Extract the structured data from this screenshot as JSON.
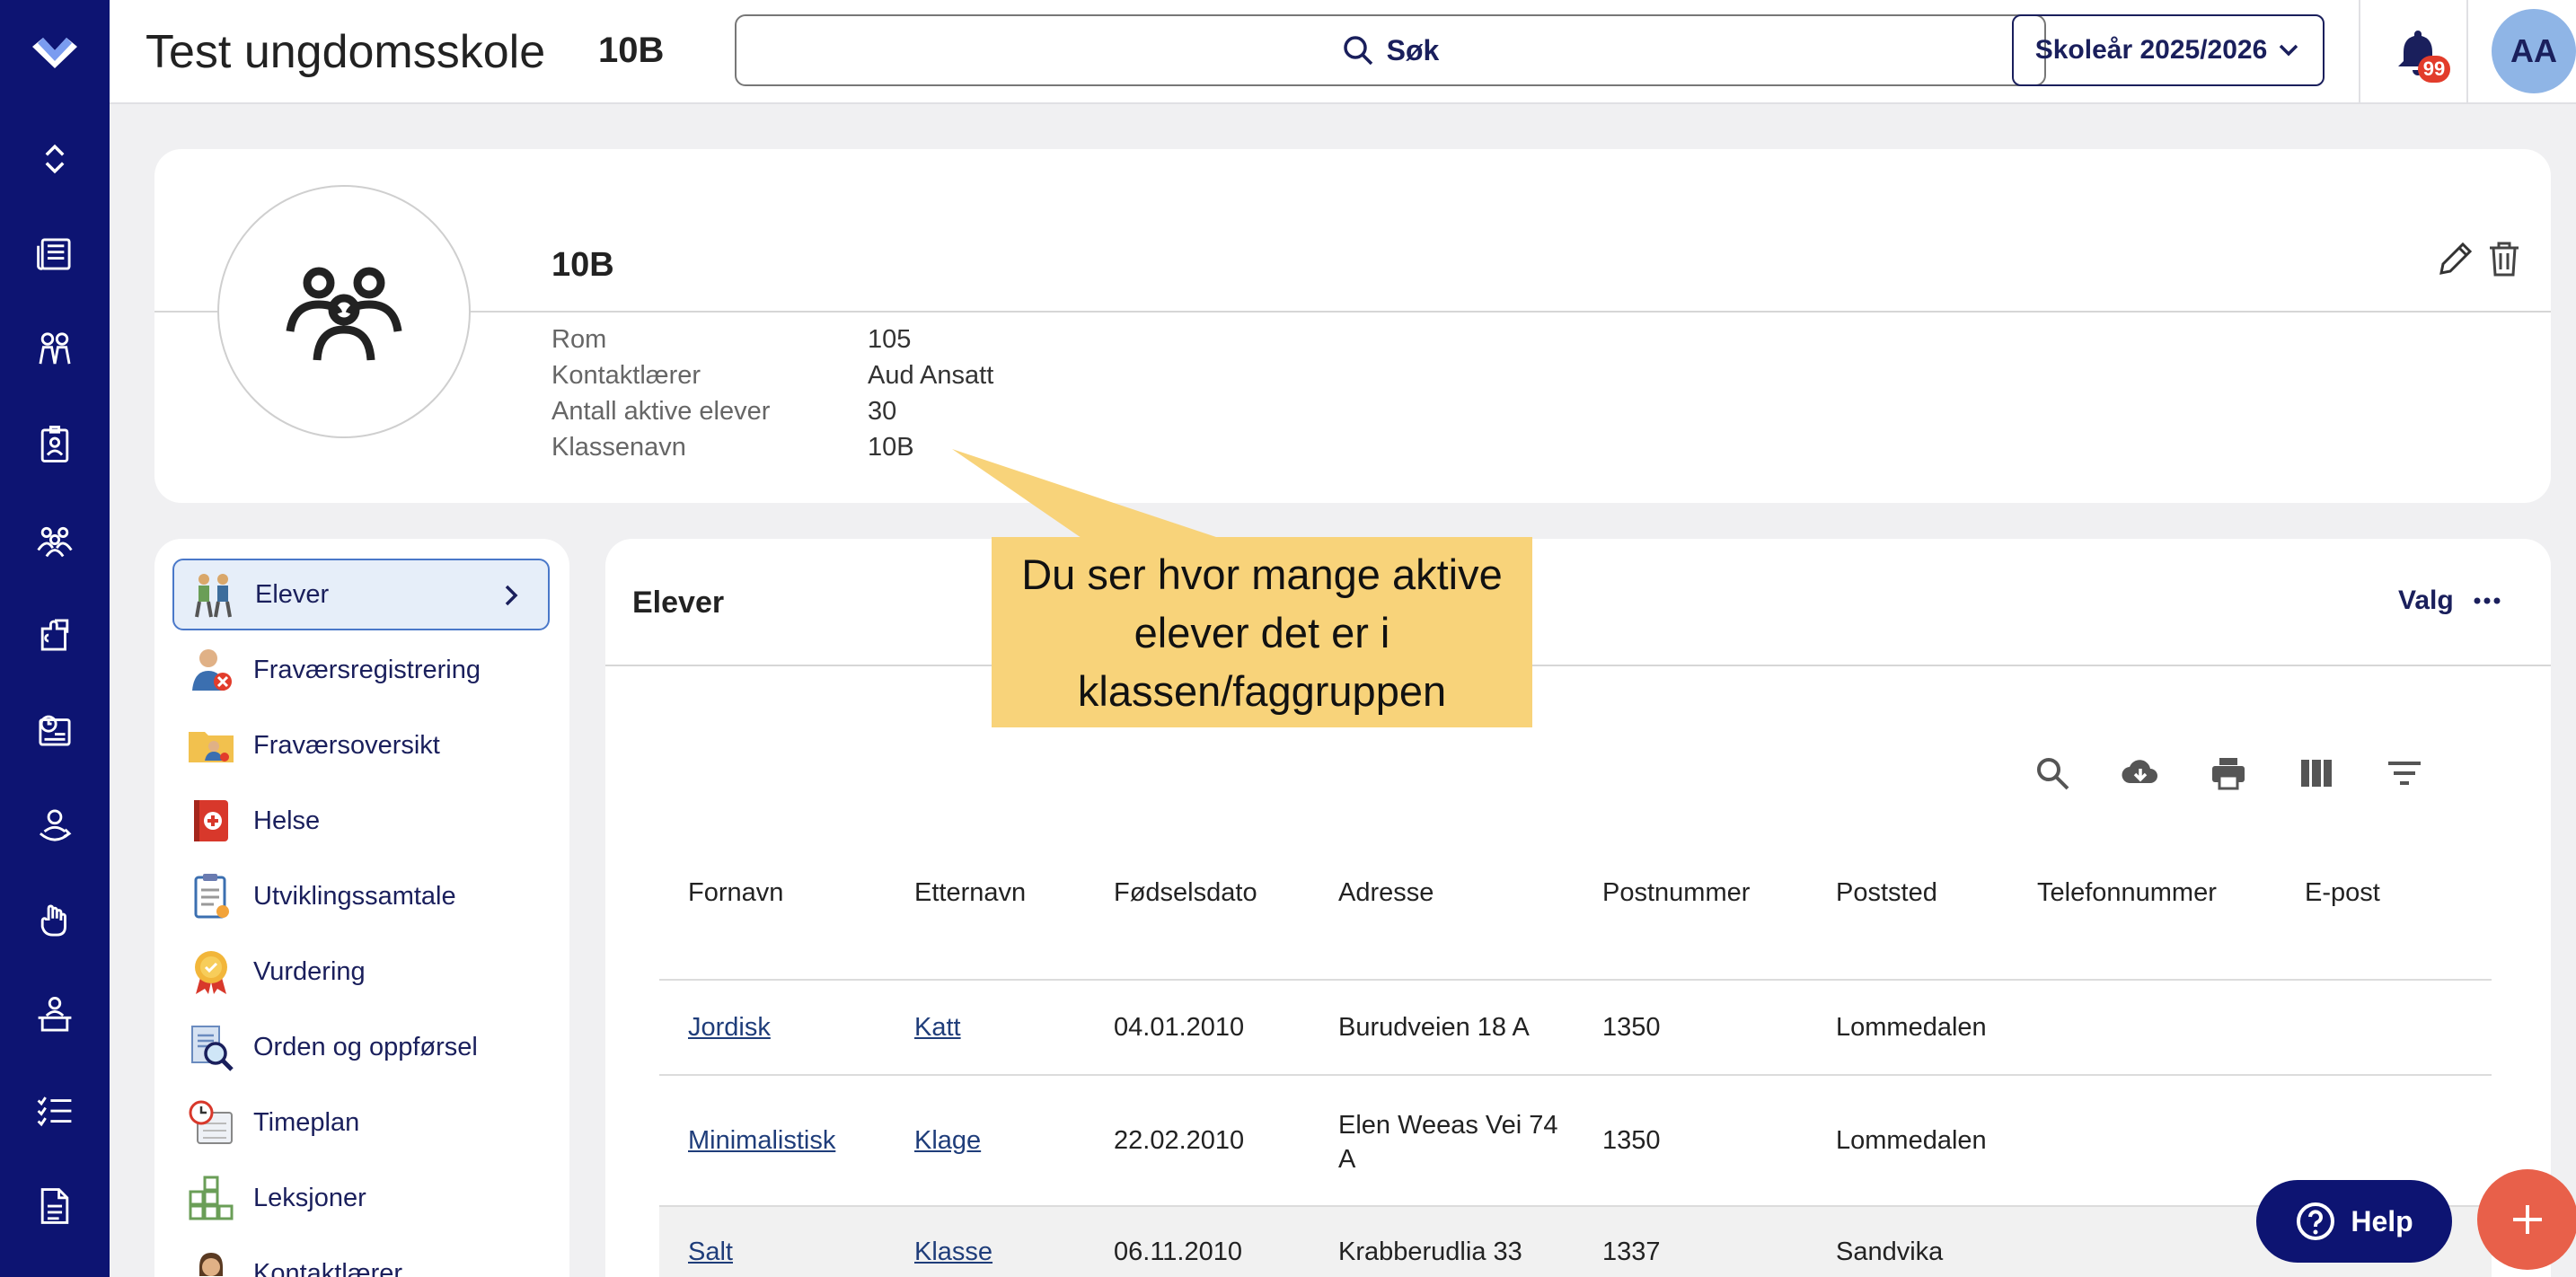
{
  "rail": {
    "icons": [
      "logo-icon",
      "expand-collapse-icon",
      "news-icon",
      "students-icon",
      "badge-icon",
      "groups-icon",
      "puzzle-icon",
      "schedule-icon",
      "user-rotate-icon",
      "hand-icon",
      "teacher-desk-icon",
      "checklist-icon",
      "document-icon"
    ]
  },
  "topbar": {
    "school": "Test ungdomsskole",
    "class": "10B",
    "search_label": "Søk",
    "year_label": "Skoleår 2025/2026",
    "notification_count": "99",
    "avatar_initials": "AA"
  },
  "info": {
    "name": "10B",
    "rows": [
      {
        "label": "Rom",
        "value": "105"
      },
      {
        "label": "Kontaktlærer",
        "value": "Aud Ansatt"
      },
      {
        "label": "Antall aktive elever",
        "value": "30"
      },
      {
        "label": "Klassenavn",
        "value": "10B"
      }
    ]
  },
  "menu": {
    "items": [
      {
        "label": "Elever",
        "icon": "students-hiking-icon"
      },
      {
        "label": "Fraværsregistrering",
        "icon": "absence-register-icon"
      },
      {
        "label": "Fraværsoversikt",
        "icon": "absence-folder-icon"
      },
      {
        "label": "Helse",
        "icon": "health-icon"
      },
      {
        "label": "Utviklingssamtale",
        "icon": "clipboard-icon"
      },
      {
        "label": "Vurdering",
        "icon": "medal-icon"
      },
      {
        "label": "Orden og oppførsel",
        "icon": "magnifier-doc-icon"
      },
      {
        "label": "Timeplan",
        "icon": "calendar-clock-icon"
      },
      {
        "label": "Leksjoner",
        "icon": "blocks-icon"
      },
      {
        "label": "Kontaktlærer",
        "icon": "teacher-icon"
      }
    ]
  },
  "students": {
    "title": "Elever",
    "valg_label": "Valg",
    "columns": [
      "Fornavn",
      "Etternavn",
      "Fødselsdato",
      "Adresse",
      "Postnummer",
      "Poststed",
      "Telefonnummer",
      "E-post"
    ],
    "rows": [
      {
        "first": "Jordisk",
        "last": "Katt",
        "dob": "04.01.2010",
        "address": "Burudveien 18 A",
        "zip": "1350",
        "city": "Lommedalen",
        "phone": "",
        "email": ""
      },
      {
        "first": "Minimalistisk",
        "last": "Klage",
        "dob": "22.02.2010",
        "address": "Elen Weeas Vei 74 A",
        "zip": "1350",
        "city": "Lommedalen",
        "phone": "",
        "email": ""
      },
      {
        "first": "Salt",
        "last": "Klasse",
        "dob": "06.11.2010",
        "address": "Krabberudlia 33",
        "zip": "1337",
        "city": "Sandvika",
        "phone": "",
        "email": ""
      }
    ]
  },
  "callout": {
    "text": "Du ser hvor mange aktive elever det er i klassen/faggruppen"
  },
  "help_label": "Help",
  "colors": {
    "rail": "#0d1472",
    "accent": "#1a1f5c",
    "callout": "#f8d37a",
    "fab": "#e8604a",
    "badge": "#e23c2b"
  }
}
